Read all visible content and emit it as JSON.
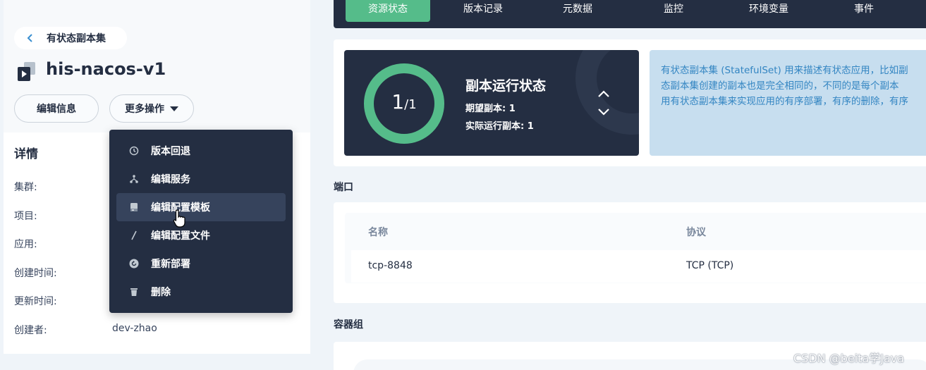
{
  "back": {
    "label": "有状态副本集"
  },
  "resource": {
    "name": "his-nacos-v1"
  },
  "actions": {
    "edit_label": "编辑信息",
    "more_label": "更多操作"
  },
  "details": {
    "title": "详情",
    "rows": [
      {
        "label": "集群:",
        "value": ""
      },
      {
        "label": "项目:",
        "value": ""
      },
      {
        "label": "应用:",
        "value": ""
      },
      {
        "label": "创建时间:",
        "value": ""
      },
      {
        "label": "更新时间:",
        "value": ""
      },
      {
        "label": "创建者:",
        "value": "dev-zhao"
      }
    ]
  },
  "menu": {
    "items": [
      {
        "label": "版本回退",
        "icon": "history-icon"
      },
      {
        "label": "编辑服务",
        "icon": "service-icon"
      },
      {
        "label": "编辑配置模板",
        "icon": "template-icon",
        "active": true
      },
      {
        "label": "编辑配置文件",
        "icon": "edit-file-icon"
      },
      {
        "label": "重新部署",
        "icon": "redeploy-icon"
      },
      {
        "label": "删除",
        "icon": "trash-icon"
      }
    ]
  },
  "tabs": [
    {
      "label": "资源状态",
      "active": true
    },
    {
      "label": "版本记录"
    },
    {
      "label": "元数据"
    },
    {
      "label": "监控"
    },
    {
      "label": "环境变量"
    },
    {
      "label": "事件"
    }
  ],
  "replica_status": {
    "running": "1",
    "total": "/1",
    "title": "副本运行状态",
    "desired_line": "期望副本: 1",
    "actual_line": "实际运行副本: 1"
  },
  "info": {
    "lines": [
      "有状态副本集 (StatefulSet) 用来描述有状态应用，比如副",
      "态副本集创建的副本也是完全相同的，不同的是每个副本",
      "用有状态副本集来实现应用的有序部署，有序的删除，有序"
    ]
  },
  "ports": {
    "title": "端口",
    "headers": [
      "名称",
      "协议"
    ],
    "rows": [
      [
        "tcp-8848",
        "TCP (TCP)"
      ]
    ]
  },
  "pods": {
    "title": "容器组"
  },
  "watermark": "CSDN @beita学Java",
  "colors": {
    "accent": "#55bc8a",
    "dark": "#242e42",
    "info_bg": "#c7deef",
    "info_text": "#3385c2"
  }
}
